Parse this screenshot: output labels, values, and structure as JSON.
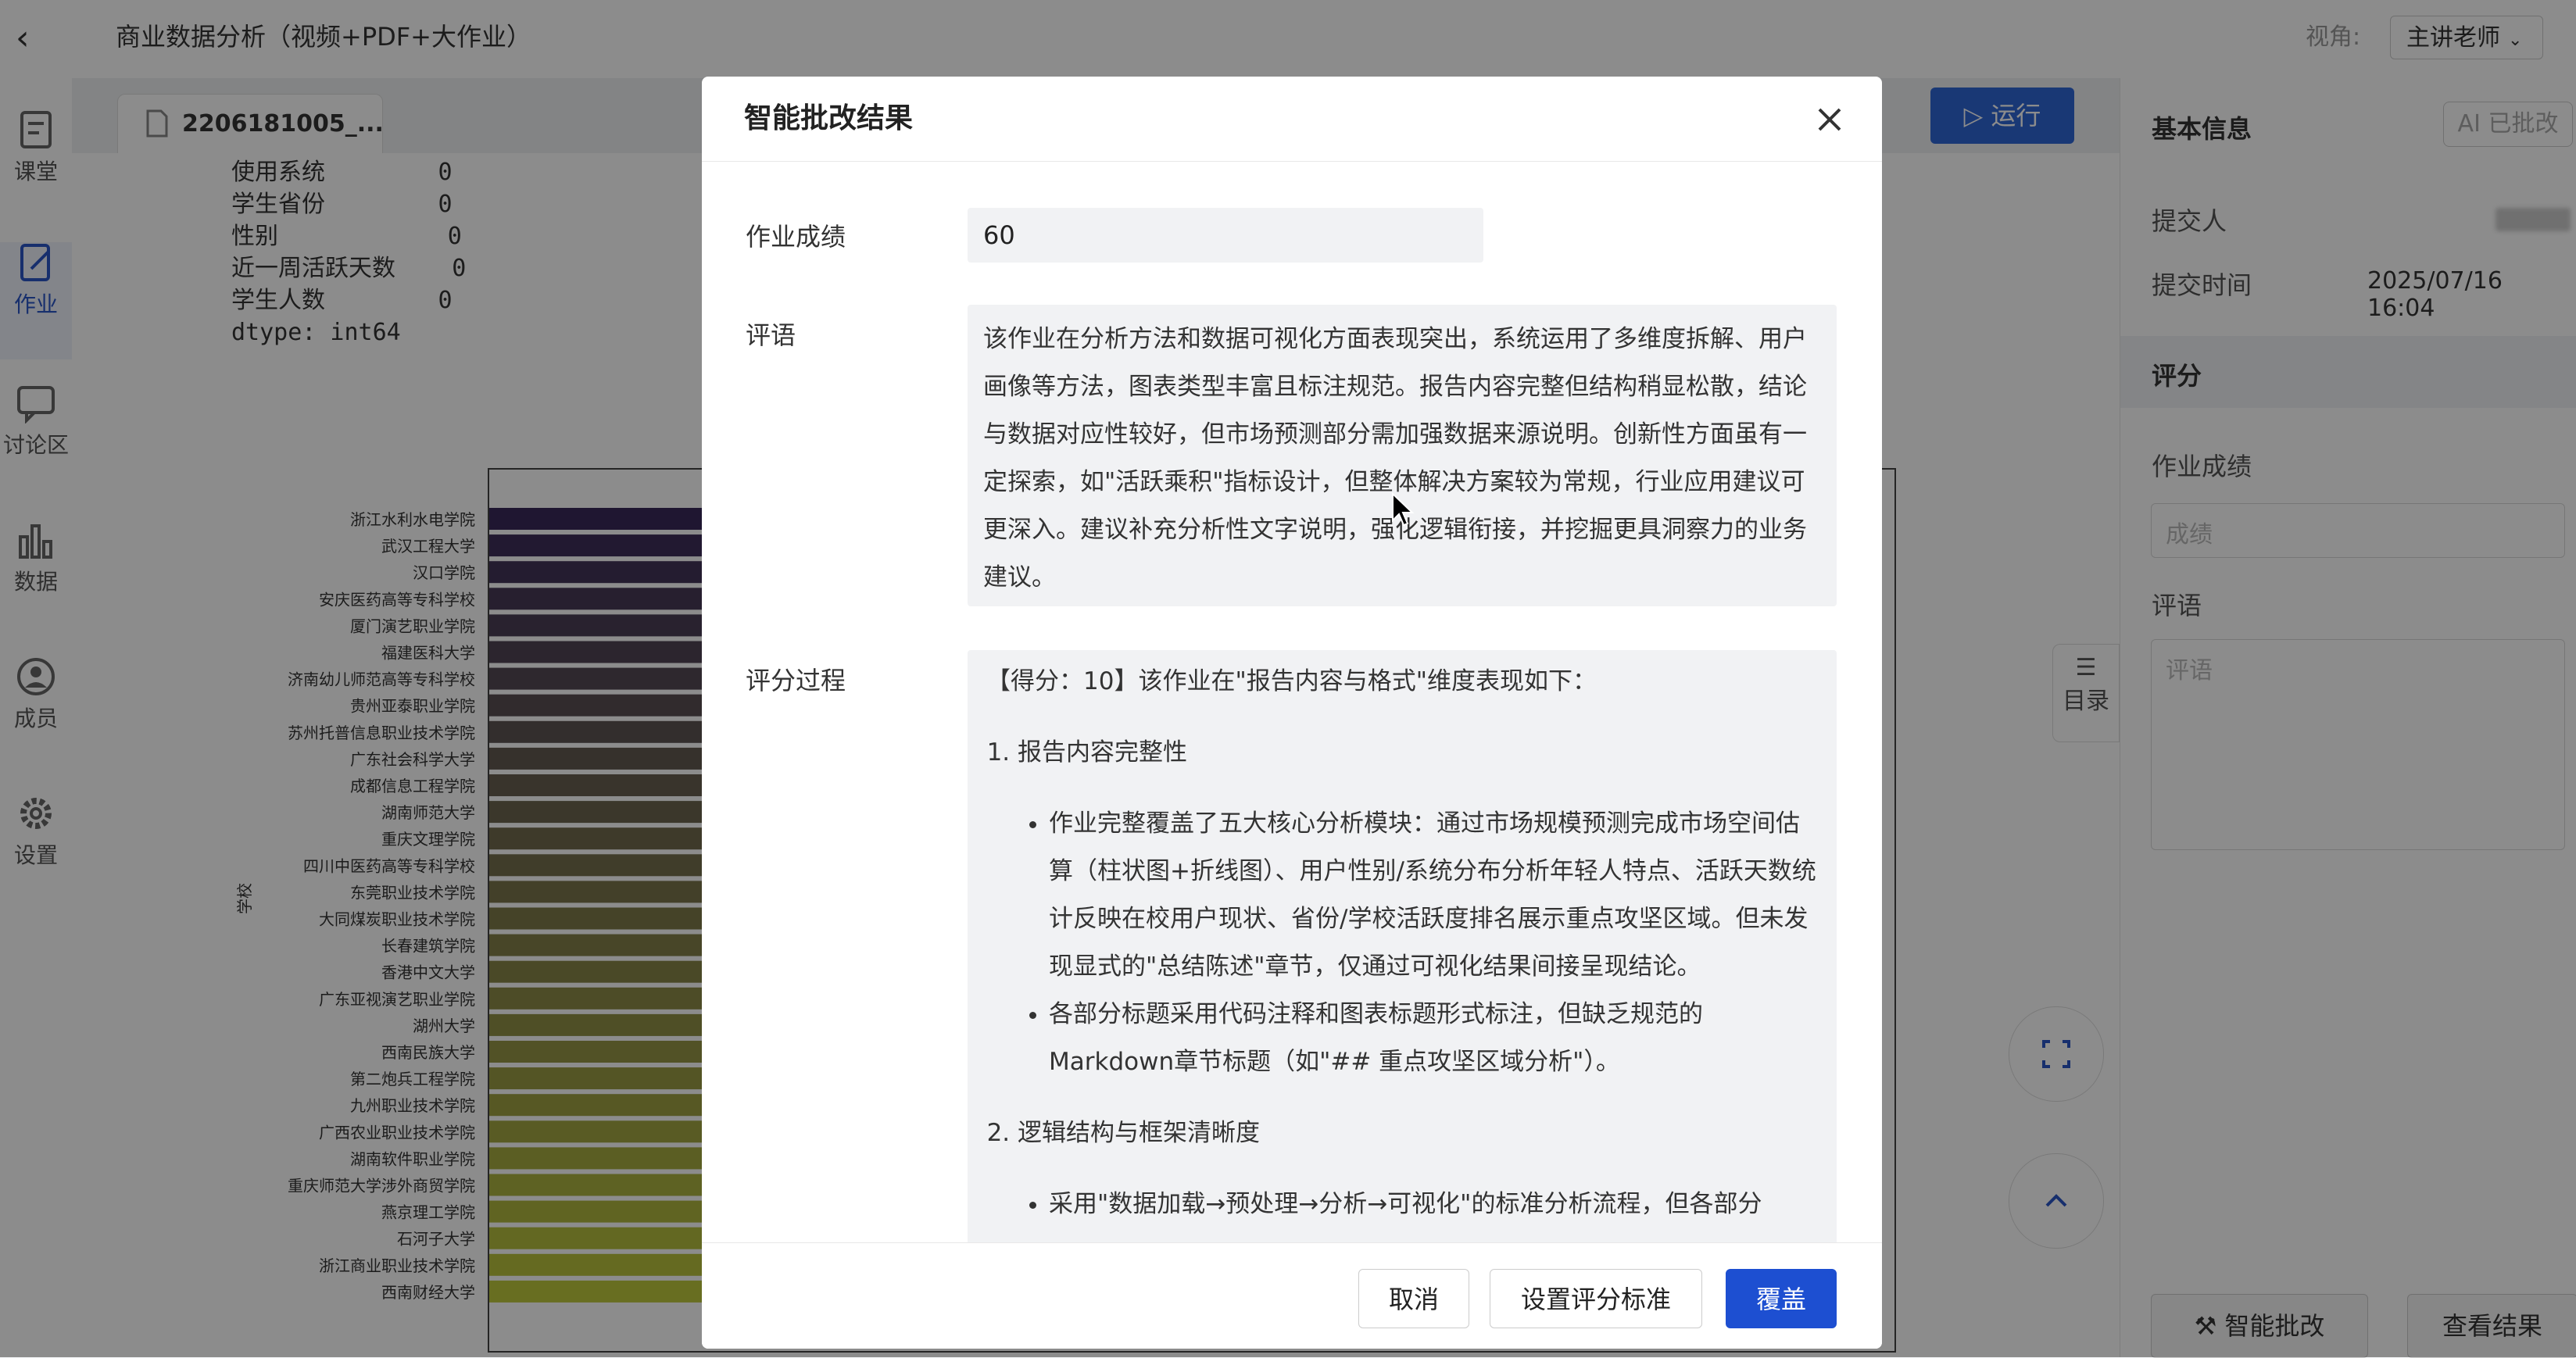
{
  "header": {
    "course_title": "商业数据分析（视频+PDF+大作业）",
    "view_label": "视角:",
    "view_value": "主讲老师"
  },
  "leftnav": {
    "items": [
      {
        "label": "课堂",
        "icon": "classroom-icon"
      },
      {
        "label": "作业",
        "icon": "assignment-icon",
        "active": true
      },
      {
        "label": "讨论区",
        "icon": "discussion-icon"
      },
      {
        "label": "数据",
        "icon": "data-bars-icon"
      },
      {
        "label": "成员",
        "icon": "member-icon"
      },
      {
        "label": "设置",
        "icon": "gear-icon"
      }
    ]
  },
  "editor": {
    "file_tab": "2206181005_...",
    "run_label": "运行",
    "console_lines": [
      "使用系统        0",
      "学生省份        0",
      "性别            0",
      "近一周活跃天数    0",
      "学生人数        0",
      "dtype: int64"
    ],
    "toc_label": "目录"
  },
  "chart_data": {
    "type": "bar",
    "orientation": "horizontal",
    "ylabel": "学校",
    "categories": [
      "浙江水利水电学院",
      "武汉工程大学",
      "汉口学院",
      "安庆医药高等专科学校",
      "厦门演艺职业学院",
      "福建医科大学",
      "济南幼儿师范高等专科学校",
      "贵州亚泰职业学院",
      "苏州托普信息职业技术学院",
      "广东社会科学大学",
      "成都信息工程学院",
      "湖南师范大学",
      "重庆文理学院",
      "四川中医药高等专科学校",
      "东莞职业技术学院",
      "大同煤炭职业技术学院",
      "长春建筑学院",
      "香港中文大学",
      "广东亚视演艺职业学院",
      "湖州大学",
      "西南民族大学",
      "第二炮兵工程学院",
      "九州职业技术学院",
      "广西农业职业技术学院",
      "湖南软件职业学院",
      "重庆师范大学涉外商贸学院",
      "燕京理工学院",
      "石河子大学",
      "浙江商业职业技术学院",
      "西南财经大学"
    ]
  },
  "right_panel": {
    "basic_info_title": "基本信息",
    "ai_badge": "AI 已批改",
    "submitter_label": "提交人",
    "submit_time_label": "提交时间",
    "submit_time_value": "2025/07/16 16:04",
    "grading_title": "评分",
    "score_label": "作业成绩",
    "score_placeholder": "成绩",
    "comment_label": "评语",
    "comment_placeholder": "评语",
    "ai_grade_button": "智能批改",
    "view_result_button": "查看结果"
  },
  "modal": {
    "title": "智能批改结果",
    "score_label": "作业成绩",
    "score_value": "60",
    "comment_label": "评语",
    "comment_text": "该作业在分析方法和数据可视化方面表现突出，系统运用了多维度拆解、用户画像等方法，图表类型丰富且标注规范。报告内容完整但结构稍显松散，结论与数据对应性较好，但市场预测部分需加强数据来源说明。创新性方面虽有一定探索，如\"活跃乘积\"指标设计，但整体解决方案较为常规，行业应用建议可更深入。建议补充分析性文字说明，强化逻辑衔接，并挖掘更具洞察力的业务建议。",
    "process_label": "评分过程",
    "process_intro": "【得分：10】该作业在\"报告内容与格式\"维度表现如下：",
    "process_h1": "报告内容完整性",
    "process_b1": "作业完整覆盖了五大核心分析模块：通过市场规模预测完成市场空间估算（柱状图+折线图）、用户性别/系统分布分析年轻人特点、活跃天数统计反映在校用户现状、省份/学校活跃度排名展示重点攻坚区域。但未发现显式的\"总结陈述\"章节，仅通过可视化结果间接呈现结论。",
    "process_b2": "各部分标题采用代码注释和图表标题形式标注，但缺乏规范的Markdown章节标题（如\"## 重点攻坚区域分析\"）。",
    "process_h2": "逻辑结构与框架清晰度",
    "process_b3": "采用\"数据加载→预处理→分析→可视化\"的标准分析流程，但各部分",
    "cancel": "取消",
    "set_criteria": "设置评分标准",
    "cover": "覆盖"
  }
}
